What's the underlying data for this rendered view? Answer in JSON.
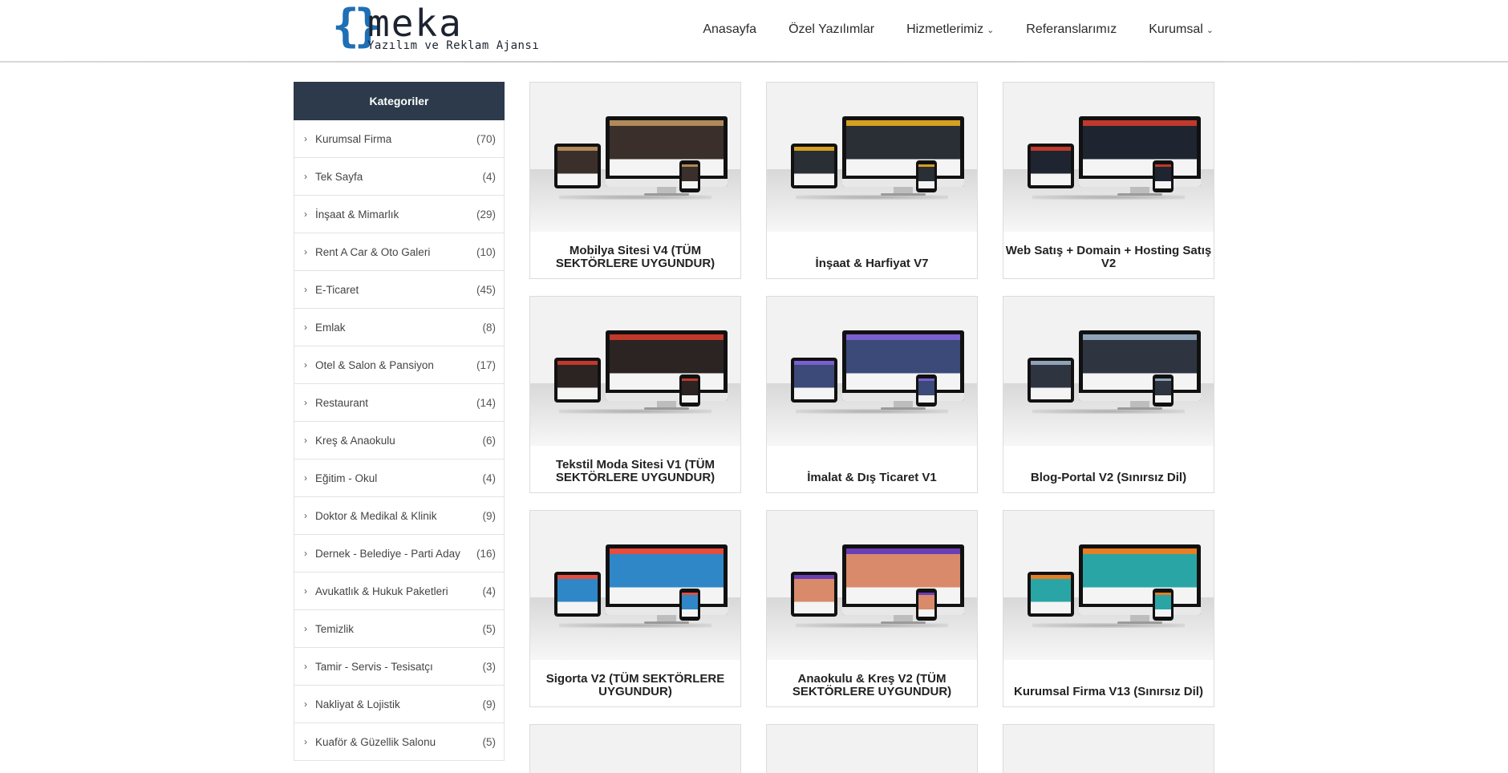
{
  "header": {
    "logo": {
      "wordmark": "meka",
      "tagline": "Yazılım ve Reklam Ajansı",
      "brand_color": "#1f6fb5"
    },
    "nav": [
      {
        "label": "Anasayfa",
        "has_dropdown": false
      },
      {
        "label": "Özel Yazılımlar",
        "has_dropdown": false
      },
      {
        "label": "Hizmetlerimiz",
        "has_dropdown": true
      },
      {
        "label": "Referanslarımız",
        "has_dropdown": false
      },
      {
        "label": "Kurumsal",
        "has_dropdown": true
      }
    ]
  },
  "sidebar": {
    "title": "Kategoriler",
    "header_color": "#2c3a4b",
    "items": [
      {
        "label": "Kurumsal Firma",
        "count": "(70)"
      },
      {
        "label": "Tek Sayfa",
        "count": "(4)"
      },
      {
        "label": "İnşaat & Mimarlık",
        "count": "(29)"
      },
      {
        "label": "Rent A Car & Oto Galeri",
        "count": "(10)"
      },
      {
        "label": "E-Ticaret",
        "count": "(45)"
      },
      {
        "label": "Emlak",
        "count": "(8)"
      },
      {
        "label": "Otel & Salon & Pansiyon",
        "count": "(17)"
      },
      {
        "label": "Restaurant",
        "count": "(14)"
      },
      {
        "label": "Kreş & Anaokulu",
        "count": "(6)"
      },
      {
        "label": "Eğitim - Okul",
        "count": "(4)"
      },
      {
        "label": "Doktor & Medikal & Klinik",
        "count": "(9)"
      },
      {
        "label": "Dernek - Belediye - Parti Aday",
        "count": "(16)"
      },
      {
        "label": "Avukatlık & Hukuk Paketleri",
        "count": "(4)"
      },
      {
        "label": "Temizlik",
        "count": "(5)"
      },
      {
        "label": "Tamir - Servis - Tesisatçı",
        "count": "(3)"
      },
      {
        "label": "Nakliyat & Lojistik",
        "count": "(9)"
      },
      {
        "label": "Kuaför & Güzellik Salonu",
        "count": "(5)"
      }
    ]
  },
  "products": [
    {
      "title": "Mobilya Sitesi V4 (TÜM SEKTÖRLERE UYGUNDUR)",
      "screen_color": "#3a2f2a",
      "accent": "#b08a5a"
    },
    {
      "title": "İnşaat & Harfiyat V7",
      "screen_color": "#2a2e35",
      "accent": "#d4a020"
    },
    {
      "title": "Web Satış + Domain + Hosting Satış V2",
      "screen_color": "#1e2530",
      "accent": "#c0392b"
    },
    {
      "title": "Tekstil Moda Sitesi V1 (TÜM SEKTÖRLERE UYGUNDUR)",
      "screen_color": "#2b2423",
      "accent": "#c0392b"
    },
    {
      "title": "İmalat & Dış Ticaret V1",
      "screen_color": "#3b4a78",
      "accent": "#7a5fd0"
    },
    {
      "title": "Blog-Portal V2 (Sınırsız Dil)",
      "screen_color": "#2e3440",
      "accent": "#8fa3b8"
    },
    {
      "title": "Sigorta V2 (TÜM SEKTÖRLERE UYGUNDUR)",
      "screen_color": "#2f87c7",
      "accent": "#e74c3c"
    },
    {
      "title": "Anaokulu & Kreş V2 (TÜM SEKTÖRLERE UYGUNDUR)",
      "screen_color": "#d98a6a",
      "accent": "#6a3fb5"
    },
    {
      "title": "Kurumsal Firma V13 (Sınırsız Dil)",
      "screen_color": "#2aa5a5",
      "accent": "#e67e22"
    },
    {
      "title": "",
      "partial": true
    },
    {
      "title": "",
      "partial": true
    },
    {
      "title": "",
      "partial": true
    }
  ]
}
